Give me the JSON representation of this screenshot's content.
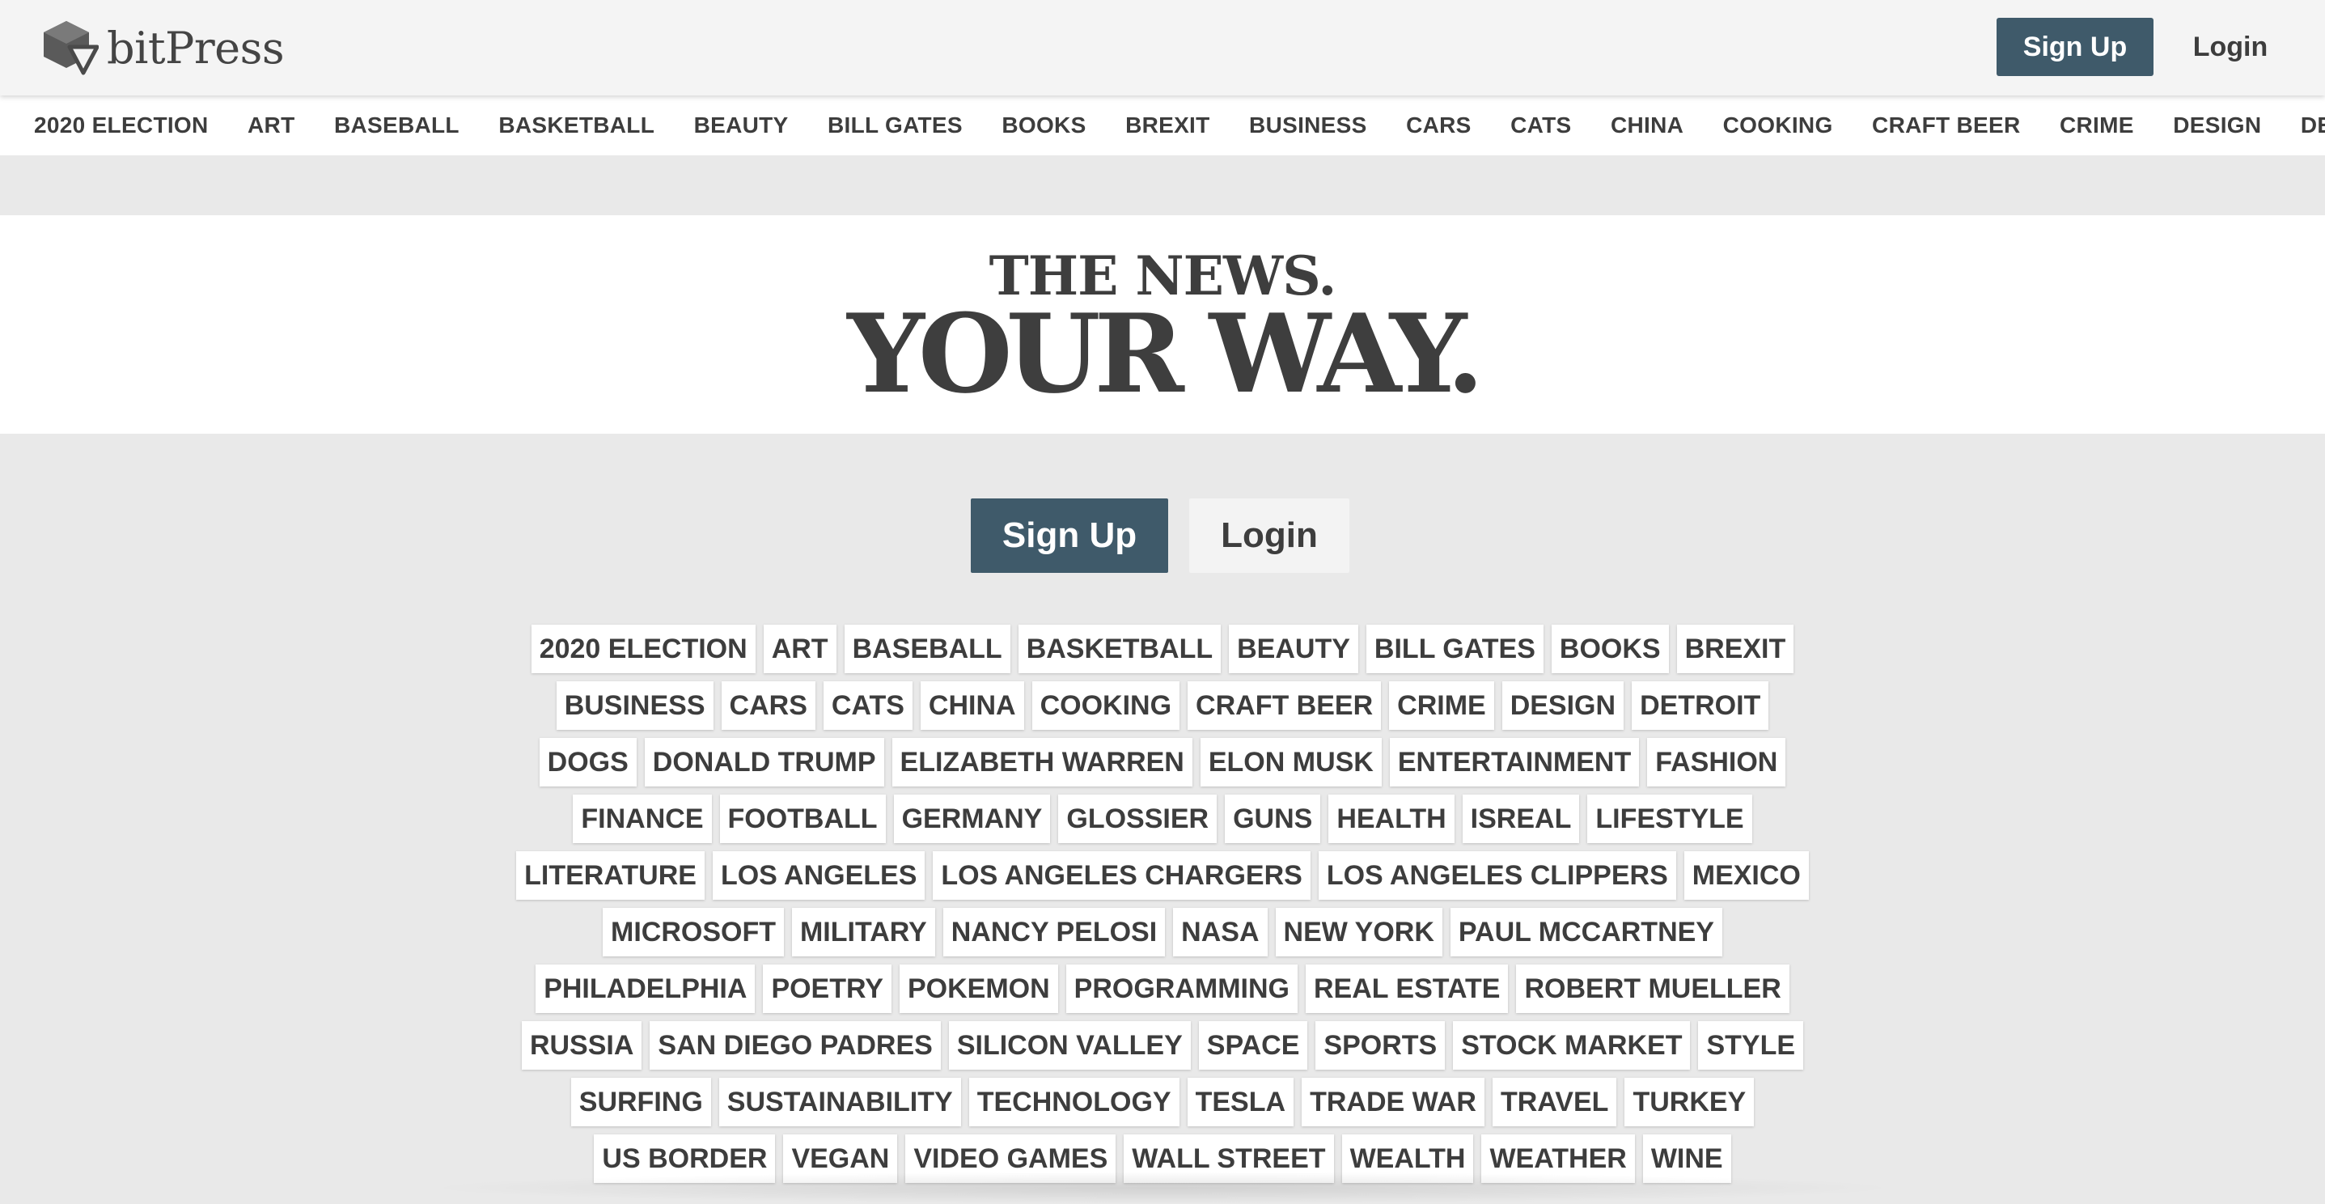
{
  "header": {
    "logo_text": "bitPress",
    "signup_label": "Sign Up",
    "login_label": "Login"
  },
  "nav": {
    "categories": [
      "2020 ELECTION",
      "ART",
      "BASEBALL",
      "BASKETBALL",
      "BEAUTY",
      "BILL GATES",
      "BOOKS",
      "BREXIT",
      "BUSINESS",
      "CARS",
      "CATS",
      "CHINA",
      "COOKING",
      "CRAFT BEER",
      "CRIME",
      "DESIGN",
      "DETROIT"
    ]
  },
  "hero": {
    "line1": "THE NEWS.",
    "line2": "YOUR WAY."
  },
  "cta": {
    "signup_label": "Sign Up",
    "login_label": "Login"
  },
  "tags": {
    "rows": [
      [
        "2020 ELECTION",
        "ART",
        "BASEBALL",
        "BASKETBALL",
        "BEAUTY",
        "BILL GATES",
        "BOOKS",
        "BREXIT"
      ],
      [
        "BUSINESS",
        "CARS",
        "CATS",
        "CHINA",
        "COOKING",
        "CRAFT BEER",
        "CRIME",
        "DESIGN",
        "DETROIT"
      ],
      [
        "DOGS",
        "DONALD TRUMP",
        "ELIZABETH WARREN",
        "ELON MUSK",
        "ENTERTAINMENT",
        "FASHION"
      ],
      [
        "FINANCE",
        "FOOTBALL",
        "GERMANY",
        "GLOSSIER",
        "GUNS",
        "HEALTH",
        "ISREAL",
        "LIFESTYLE"
      ],
      [
        "LITERATURE",
        "LOS ANGELES",
        "LOS ANGELES CHARGERS",
        "LOS ANGELES CLIPPERS",
        "MEXICO"
      ],
      [
        "MICROSOFT",
        "MILITARY",
        "NANCY PELOSI",
        "NASA",
        "NEW YORK",
        "PAUL MCCARTNEY"
      ],
      [
        "PHILADELPHIA",
        "POETRY",
        "POKEMON",
        "PROGRAMMING",
        "REAL ESTATE",
        "ROBERT MUELLER"
      ],
      [
        "RUSSIA",
        "SAN DIEGO PADRES",
        "SILICON VALLEY",
        "SPACE",
        "SPORTS",
        "STOCK MARKET",
        "STYLE"
      ],
      [
        "SURFING",
        "SUSTAINABILITY",
        "TECHNOLOGY",
        "TESLA",
        "TRADE WAR",
        "TRAVEL",
        "TURKEY"
      ],
      [
        "US BORDER",
        "VEGAN",
        "VIDEO GAMES",
        "WALL STREET",
        "WEALTH",
        "WEATHER",
        "WINE"
      ]
    ]
  },
  "colors": {
    "accent": "#3f5a6a",
    "page_bg": "#e9e9e9",
    "text": "#3d3d3d"
  }
}
